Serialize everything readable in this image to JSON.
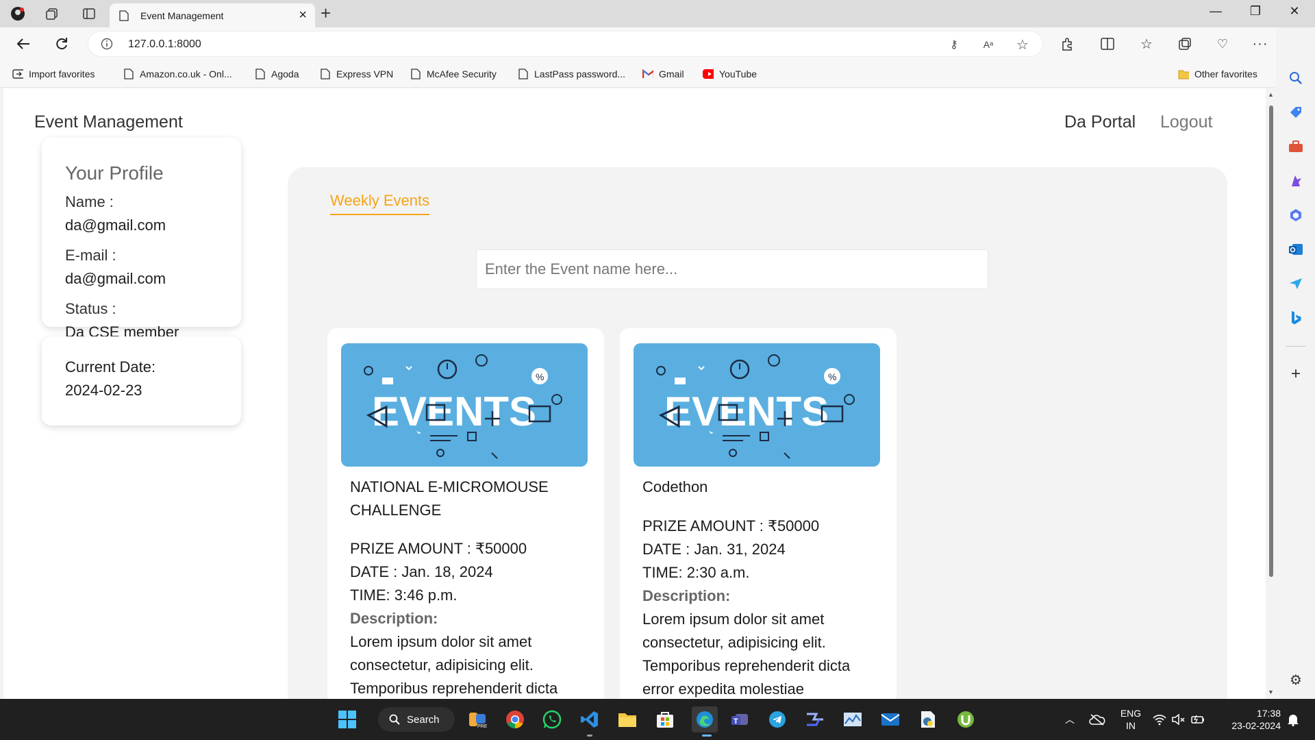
{
  "browser": {
    "tab_title": "Event Management",
    "url": "127.0.0.1:8000",
    "favorites": [
      {
        "label": "Import favorites",
        "icon": "import-icon"
      },
      {
        "label": "Amazon.co.uk - Onl...",
        "icon": "page-icon"
      },
      {
        "label": "Agoda",
        "icon": "page-icon"
      },
      {
        "label": "Express VPN",
        "icon": "page-icon"
      },
      {
        "label": "McAfee Security",
        "icon": "page-icon"
      },
      {
        "label": "LastPass password...",
        "icon": "page-icon"
      },
      {
        "label": "Gmail",
        "icon": "gmail-icon"
      },
      {
        "label": "YouTube",
        "icon": "youtube-icon"
      }
    ],
    "other_favorites": "Other favorites"
  },
  "site": {
    "brand": "Event Management",
    "nav": {
      "portal": "Da Portal",
      "logout": "Logout"
    }
  },
  "profile": {
    "title": "Your Profile",
    "name_label": "Name :",
    "name_value": "da@gmail.com",
    "email_label": "E-mail :",
    "email_value": "da@gmail.com",
    "status_label": "Status :",
    "status_value": "Da CSE member"
  },
  "date_card": {
    "label": "Current Date:",
    "value": "2024-02-23"
  },
  "events_panel": {
    "tab": "Weekly Events",
    "search_placeholder": "Enter the Event name here...",
    "image_text": "EVENTS"
  },
  "events": [
    {
      "title_line1": "NATIONAL E-MICROMOUSE",
      "title_line2": "CHALLENGE",
      "prize": "PRIZE AMOUNT : ₹50000",
      "date": "DATE : Jan. 18, 2024",
      "time": "TIME: 3:46 p.m.",
      "desc_label": "Description:",
      "desc1": "Lorem ipsum dolor sit amet",
      "desc2": "consectetur, adipisicing elit.",
      "desc3": "Temporibus reprehenderit dicta"
    },
    {
      "title_line1": "Codethon",
      "prize": "PRIZE AMOUNT : ₹50000",
      "date": "DATE : Jan. 31, 2024",
      "time": "TIME: 2:30 a.m.",
      "desc_label": "Description:",
      "desc1": "Lorem ipsum dolor sit amet",
      "desc2": "consectetur, adipisicing elit.",
      "desc3": "Temporibus reprehenderit dicta",
      "desc4": "error expedita molestiae"
    }
  ],
  "taskbar": {
    "search": "Search",
    "lang1": "ENG",
    "lang2": "IN",
    "time": "17:38",
    "date": "23-02-2024"
  },
  "colors": {
    "accent_orange": "#f5a417",
    "event_image_bg": "#5aafe0",
    "panel_bg": "#f3f3f3"
  }
}
